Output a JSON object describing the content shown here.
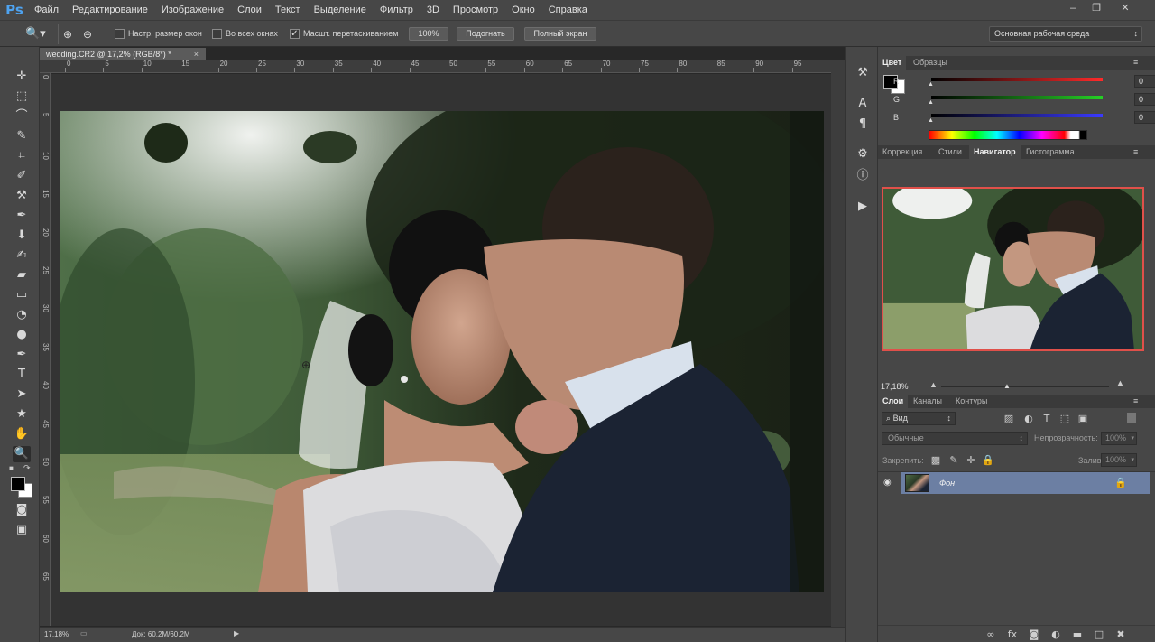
{
  "app": {
    "logo": "Ps",
    "menu": [
      "Файл",
      "Редактирование",
      "Изображение",
      "Слои",
      "Текст",
      "Выделение",
      "Фильтр",
      "3D",
      "Просмотр",
      "Окно",
      "Справка"
    ]
  },
  "options_bar": {
    "resize_windows_label": "Настр. размер окон",
    "all_windows_label": "Во всех окнах",
    "scrubby_zoom_label": "Масшт. перетаскиванием",
    "scrubby_zoom_checked": true,
    "zoom_100": "100%",
    "fit_screen": "Подогнать",
    "full_screen": "Полный экран",
    "workspace": "Основная рабочая среда"
  },
  "document": {
    "tab_title": "wedding.CR2 @ 17,2% (RGB/8*) *",
    "ruler_h": [
      "0",
      "5",
      "10",
      "15",
      "20",
      "25",
      "30",
      "35",
      "40",
      "45",
      "50",
      "55",
      "60",
      "65",
      "70",
      "75",
      "80",
      "85",
      "90",
      "95"
    ],
    "ruler_v": [
      "0",
      "5",
      "10",
      "15",
      "20",
      "25",
      "30",
      "35",
      "40",
      "45",
      "50",
      "55",
      "60",
      "65"
    ],
    "zoom": "17,18%",
    "doc_size": "Док: 60,2M/60,2M"
  },
  "color_panel": {
    "tabs": [
      "Цвет",
      "Образцы"
    ],
    "r_label": "R",
    "g_label": "G",
    "b_label": "B",
    "r": "0",
    "g": "0",
    "b": "0"
  },
  "navigator_panel": {
    "tabs": [
      "Коррекция",
      "Стили",
      "Навигатор",
      "Гистограмма"
    ],
    "zoom": "17,18%"
  },
  "layers_panel": {
    "tabs": [
      "Слои",
      "Каналы",
      "Контуры"
    ],
    "filter_kind": "Вид",
    "blend_mode": "Обычные",
    "opacity_label": "Непрозрачность:",
    "opacity": "100%",
    "lock_label": "Закрепить:",
    "fill_label": "Заливка:",
    "fill": "100%",
    "layers": [
      {
        "name": "Фон"
      }
    ]
  },
  "colors": {
    "accent": "#4ea3f0",
    "navigator_frame": "#e0504a",
    "selected_layer": "#6c7fa3"
  }
}
